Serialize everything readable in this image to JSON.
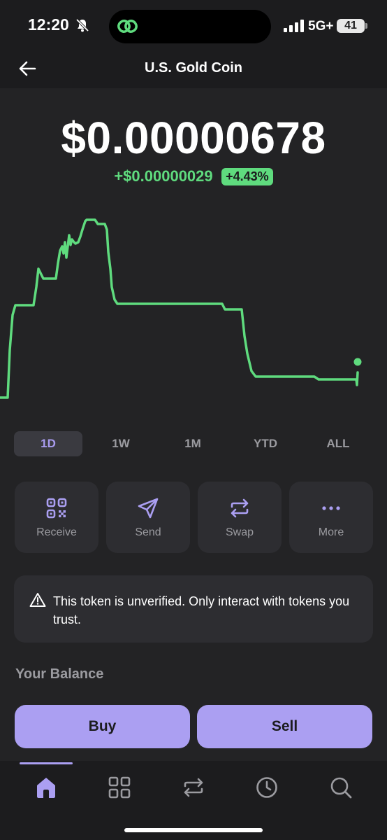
{
  "status_bar": {
    "time": "12:20",
    "network": "5G+",
    "battery": "41"
  },
  "header": {
    "title": "U.S. Gold Coin",
    "back_icon": "arrow-left-icon"
  },
  "price": {
    "value": "$0.00000678",
    "change_amount": "+$0.00000029",
    "change_percent": "+4.43%",
    "positive_color": "#5fdb7e"
  },
  "chart_data": {
    "type": "line",
    "color": "#5fdb7e",
    "grid": false,
    "axes_shown": false,
    "end_marker": true
  },
  "range_tabs": {
    "items": [
      {
        "label": "1D",
        "active": true
      },
      {
        "label": "1W",
        "active": false
      },
      {
        "label": "1M",
        "active": false
      },
      {
        "label": "YTD",
        "active": false
      },
      {
        "label": "ALL",
        "active": false
      }
    ]
  },
  "actions": [
    {
      "label": "Receive",
      "icon": "qr-code-icon"
    },
    {
      "label": "Send",
      "icon": "send-icon"
    },
    {
      "label": "Swap",
      "icon": "swap-icon"
    },
    {
      "label": "More",
      "icon": "more-dots-icon"
    }
  ],
  "warning": {
    "icon": "warning-triangle-icon",
    "text": "This token is unverified. Only interact with tokens you trust."
  },
  "balance": {
    "title": "Your Balance"
  },
  "cta": {
    "buy_label": "Buy",
    "sell_label": "Sell"
  },
  "tab_bar": {
    "items": [
      "home-icon",
      "grid-icon",
      "swap-icon",
      "clock-icon",
      "search-icon"
    ],
    "active_index": 0,
    "accent": "#ab9ff2"
  }
}
